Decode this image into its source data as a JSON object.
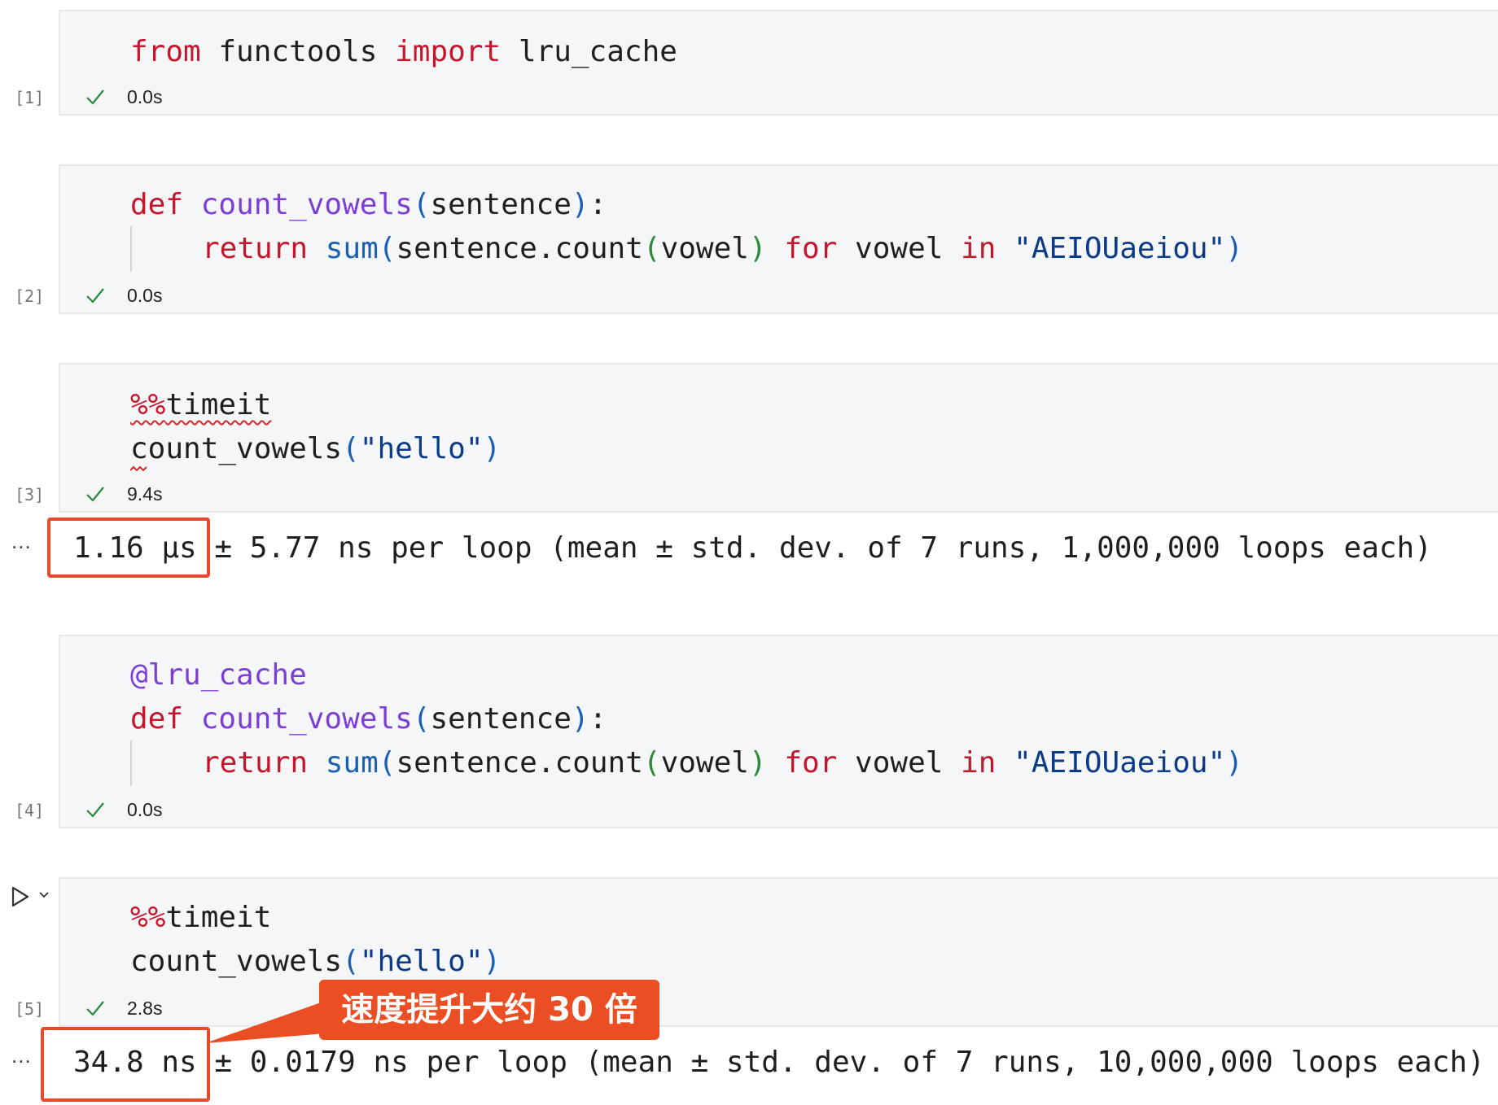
{
  "cells": [
    {
      "exec_count": "[1]",
      "time": "0.0s",
      "lines": [
        {
          "from": "from",
          "mod": " functools ",
          "imp": "import",
          "name": " lru_cache"
        }
      ]
    },
    {
      "exec_count": "[2]",
      "time": "0.0s",
      "def": "def",
      "fname": "count_vowels",
      "lparen": "(",
      "param": "sentence",
      "rparen": ")",
      "colon": ":",
      "ret": "return",
      "sum": "sum",
      "sum_lp": "(",
      "expr": "sentence.count",
      "inner_lp": "(",
      "var": "vowel",
      "inner_rp": ")",
      "for": "for",
      "var2": "vowel",
      "in": "in",
      "string": "\"AEIOUaeiou\"",
      "sum_rp": ")"
    },
    {
      "exec_count": "[3]",
      "time": "9.4s",
      "magic": "%%",
      "magic_name": "timeit",
      "call": "count_vowels",
      "lp": "(",
      "arg": "\"hello\"",
      "rp": ")",
      "output_value": "1.16 µs",
      "output_rest": " ± 5.77 ns per loop (mean ± std. dev. of 7 runs, 1,000,000 loops each)"
    },
    {
      "exec_count": "[4]",
      "time": "0.0s",
      "decorator": "@lru_cache",
      "def": "def",
      "fname": "count_vowels",
      "lparen": "(",
      "param": "sentence",
      "rparen": ")",
      "colon": ":",
      "ret": "return",
      "sum": "sum",
      "sum_lp": "(",
      "expr": "sentence.count",
      "inner_lp": "(",
      "var": "vowel",
      "inner_rp": ")",
      "for": "for",
      "var2": "vowel",
      "in": "in",
      "string": "\"AEIOUaeiou\"",
      "sum_rp": ")"
    },
    {
      "exec_count": "[5]",
      "time": "2.8s",
      "magic": "%%",
      "magic_name": "timeit",
      "call": "count_vowels",
      "lp": "(",
      "arg": "\"hello\"",
      "rp": ")",
      "output_value": "34.8 ns",
      "output_rest": " ± 0.0179 ns per loop (mean ± std. dev. of 7 runs, 10,000,000 loops each)"
    }
  ],
  "output_ellipsis": "...",
  "annotation": {
    "callout_text": "速度提升大约 30 倍",
    "color": "#ec4e24"
  },
  "icons": {
    "status": "check-icon",
    "run": "run-cell-icon",
    "expand": "chevron-down-icon"
  },
  "colors": {
    "keyword": "#c5162c",
    "function": "#7d3ed8",
    "builtin": "#1a5fb4",
    "string": "#0b3a87",
    "success": "#2a8a3a",
    "cell_bg": "#f5f6f8"
  }
}
